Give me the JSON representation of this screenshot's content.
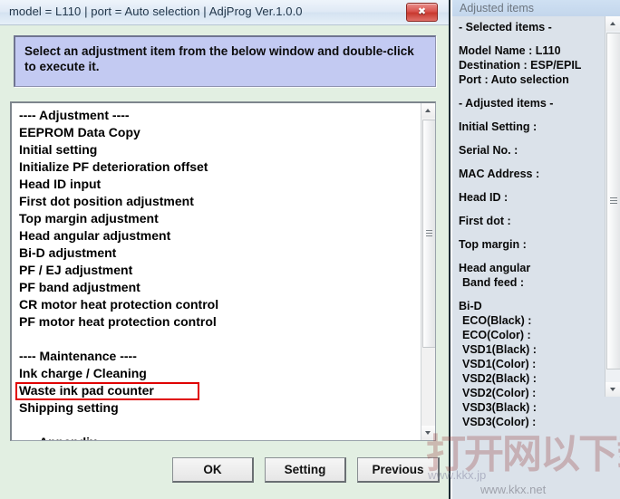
{
  "window": {
    "title": "model = L110 | port = Auto selection | AdjProg Ver.1.0.0",
    "close_label": "✖",
    "close_icon": "close-icon"
  },
  "instruction": {
    "text": "Select an adjustment item from the below window and double-click to execute it."
  },
  "list": {
    "items": [
      {
        "label": "---- Adjustment ----",
        "type": "header"
      },
      {
        "label": "EEPROM Data Copy",
        "type": "item"
      },
      {
        "label": "Initial setting",
        "type": "item"
      },
      {
        "label": "Initialize PF deterioration offset",
        "type": "item"
      },
      {
        "label": "Head ID input",
        "type": "item"
      },
      {
        "label": "First dot position adjustment",
        "type": "item"
      },
      {
        "label": "Top margin adjustment",
        "type": "item"
      },
      {
        "label": "Head angular adjustment",
        "type": "item"
      },
      {
        "label": "Bi-D adjustment",
        "type": "item"
      },
      {
        "label": "PF / EJ adjustment",
        "type": "item"
      },
      {
        "label": "PF band adjustment",
        "type": "item"
      },
      {
        "label": "CR motor heat protection control",
        "type": "item"
      },
      {
        "label": "PF motor heat protection control",
        "type": "item"
      },
      {
        "label": "",
        "type": "blank"
      },
      {
        "label": "---- Maintenance ----",
        "type": "header"
      },
      {
        "label": "Ink charge / Cleaning",
        "type": "item"
      },
      {
        "label": "Waste ink pad counter",
        "type": "item",
        "highlighted": true
      },
      {
        "label": "Shipping setting",
        "type": "item"
      },
      {
        "label": "",
        "type": "blank"
      },
      {
        "label": "---- Appendix ----",
        "type": "header"
      }
    ],
    "highlight_color": "#e00000"
  },
  "buttons": {
    "ok": "OK",
    "setting": "Setting",
    "previous": "Previous"
  },
  "right_panel": {
    "header": "Adjusted items",
    "lines": [
      {
        "text": "- Selected items -",
        "type": "line"
      },
      {
        "text": "",
        "type": "gap"
      },
      {
        "text": "Model Name : L110",
        "type": "line"
      },
      {
        "text": "Destination : ESP/EPIL",
        "type": "line"
      },
      {
        "text": "Port : Auto selection",
        "type": "line"
      },
      {
        "text": "",
        "type": "gap"
      },
      {
        "text": "- Adjusted items -",
        "type": "line"
      },
      {
        "text": "",
        "type": "gap"
      },
      {
        "text": "Initial Setting :",
        "type": "line"
      },
      {
        "text": "",
        "type": "gap"
      },
      {
        "text": "Serial No. :",
        "type": "line"
      },
      {
        "text": "",
        "type": "gap"
      },
      {
        "text": "MAC Address :",
        "type": "line"
      },
      {
        "text": "",
        "type": "gap"
      },
      {
        "text": "Head ID :",
        "type": "line"
      },
      {
        "text": "",
        "type": "gap"
      },
      {
        "text": "First dot :",
        "type": "line"
      },
      {
        "text": "",
        "type": "gap"
      },
      {
        "text": "Top margin :",
        "type": "line"
      },
      {
        "text": "",
        "type": "gap"
      },
      {
        "text": "Head angular",
        "type": "line"
      },
      {
        "text": "Band feed :",
        "type": "sub"
      },
      {
        "text": "",
        "type": "gap"
      },
      {
        "text": "Bi-D",
        "type": "line"
      },
      {
        "text": "ECO(Black)  :",
        "type": "sub"
      },
      {
        "text": "ECO(Color)  :",
        "type": "sub"
      },
      {
        "text": "VSD1(Black) :",
        "type": "sub"
      },
      {
        "text": "VSD1(Color) :",
        "type": "sub"
      },
      {
        "text": "VSD2(Black) :",
        "type": "sub"
      },
      {
        "text": "VSD2(Color) :",
        "type": "sub"
      },
      {
        "text": "VSD3(Black) :",
        "type": "sub"
      },
      {
        "text": "VSD3(Color) :",
        "type": "sub"
      }
    ]
  },
  "watermark": {
    "cn": "打开网以下载",
    "url1": "www.kkx.jp",
    "url2": "www.kkx.net"
  },
  "colors": {
    "body_bg": "#e2efe2",
    "instruction_bg": "#c3caf2",
    "right_panel_bg": "#dbe2ea",
    "highlight": "#e00000",
    "close_button": "#d9534e"
  }
}
